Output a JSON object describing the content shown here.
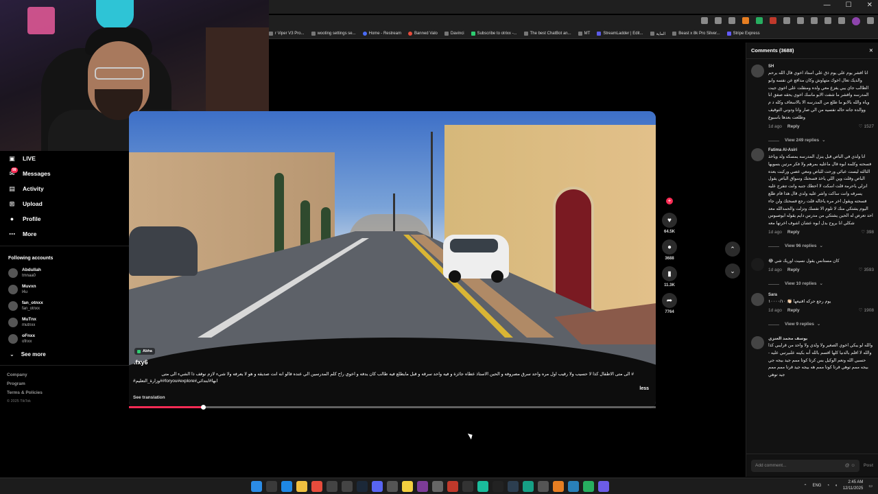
{
  "bookmarks": [
    "r Viper V3 Pro...",
    "wooting settings se...",
    "Home - Restream",
    "Banned Valo",
    "Davinci",
    "Subscribe to otrixx -...",
    "The best ChatBot an...",
    "MT",
    "StreamLadder | Edit...",
    "الماية",
    "Beast x 8k Pro Silver...",
    "Stripe Express"
  ],
  "nav": {
    "items": [
      {
        "label": "LIVE",
        "icon": "live-icon"
      },
      {
        "label": "Messages",
        "icon": "messages-icon",
        "badge": "99"
      },
      {
        "label": "Activity",
        "icon": "activity-icon"
      },
      {
        "label": "Upload",
        "icon": "upload-icon"
      },
      {
        "label": "Profile",
        "icon": "profile-icon"
      },
      {
        "label": "More",
        "icon": "more-icon"
      }
    ],
    "following_title": "Following accounts",
    "accounts": [
      {
        "name": "Abdullah",
        "handle": "tmnaa0"
      },
      {
        "name": "Muvxn",
        "handle": "l4u"
      },
      {
        "name": "fan_otnxx",
        "handle": "fan_otnxx"
      },
      {
        "name": "MuTnx",
        "handle": "mutnxx"
      },
      {
        "name": "oFnxx",
        "handle": "ofnxx"
      }
    ],
    "see_more": "See more",
    "footer": [
      "Company",
      "Program",
      "Terms & Policies"
    ],
    "copyright": "© 2025 TikTok"
  },
  "video": {
    "location": "Abha",
    "author": ".fxy6",
    "caption": "# الى متى الاطفال كذا لا حسيب ولا رقيب اول مره واحد سرق مصروفه و الحين الاستاذ عطاه جائزة و فيه واحد سرقه و قبل مايطلع فيه طالب كان يدفه و اخوي راح كلم المدرسين الي عنده قالو انه انت صديقه و هو لا يعرفه ولا شيء لازم نوقف ذا الشيء الى متى",
    "hashtags": "ابها#ابتدائي#foryou#explore##وزارة_التعليم#",
    "see_translation": "See translation",
    "less": "less",
    "progress": 0.14
  },
  "actions": {
    "likes": "64.5K",
    "comments": "3688",
    "saves": "11.3K",
    "shares": "7764"
  },
  "comments": {
    "title": "Comments (3688)",
    "items": [
      {
        "user": "SH",
        "text": "انا اقشر يوم علي يوم ذق علي استاذ اخوي قال الله يرحم والديك تعال اخوك متهاوش وكان مدافع عن نفسه وابو الطالب جاي يبي يفزع معي ولده ومنقلت على اخوي جيت المدرسه واقشر ما شفت الابو ماسك اخوي يحقه صفق انا وياه والله بالابو ما طلع من المدرسه الا بالاسعاف وكله د م ووالده جاته حاله نفسيه من الي صار وانا ودوني التوقيف وطلعت بعدها باسبوع",
        "time": "1d ago",
        "reply": "Reply",
        "likes": "1527",
        "replies": "View 249 replies"
      },
      {
        "user": "Fatima Al-Asiri",
        "text": "انا ولدي في الباص قبل ينزل المدرسه يمسكه ولد وياخذ فسحته وكلمة ابوه قال ماعليه بمرهم ولا فكر مرتين بسويها الثالثه ليست عبائي ورحت للباص ومعي عصي وركبت بعده الباص وقلت وين اللي ياخذ فسحتك وسواق الباص يقول انزلي باحرمة قلت اسكت لا احطك جنبه وانت تتفرج عليه يسرقه وانت ساكت واشر عليه ولدي قال هذا قام طلع فسحته ويقول اخر مره ياخاله قلت رجع فسحتك ولن جاء اليوم يشتكي منك لا تلوم الا نفسك وتزلت والحمدالله معد احد تعرض له الحين يشتكي من مدرس دايم يقوله ابوصبوس شكلي انا بروح بدل ابوه عشان اشوف اخرتها معه",
        "time": "1d ago",
        "reply": "Reply",
        "likes": "398",
        "replies": "View 96 replies"
      },
      {
        "user": "",
        "text": "كان مستانس يقول نسيت اوريك شي 😂",
        "time": "1d ago",
        "reply": "Reply",
        "likes": "3593",
        "replies": "View 10 replies"
      },
      {
        "user": "Sara",
        "text": "يوم رجع حركه اقنيعها 👏🏻 ١٠٠٠٠/١٠",
        "time": "1d ago",
        "reply": "Reply",
        "likes": "1908",
        "replies": "View 9 replies"
      },
      {
        "user": "يوسف محمد العنزي",
        "text": "والله لو يبكي اخوي الصغير ولا ولدي ولا واحد من قرايبي كذا والله لا اقلم بالدنيا كلها اقسم بالله أنه بكيته علىيرتبي عليه - حسبي الله ونعم الوكيل بس كرتا كوتا ممم جيد بيجه جي بيجه ممم توهي قرتا كوتا ممم هه بيجه جيد قرتا ممم ممم جيد توهي",
        "time": "",
        "reply": "",
        "likes": "",
        "replies": ""
      }
    ],
    "input_placeholder": "Add comment...",
    "post": "Post"
  },
  "tray": {
    "lang": "ENG",
    "time": "2:45 AM",
    "date": "12/11/2025"
  }
}
